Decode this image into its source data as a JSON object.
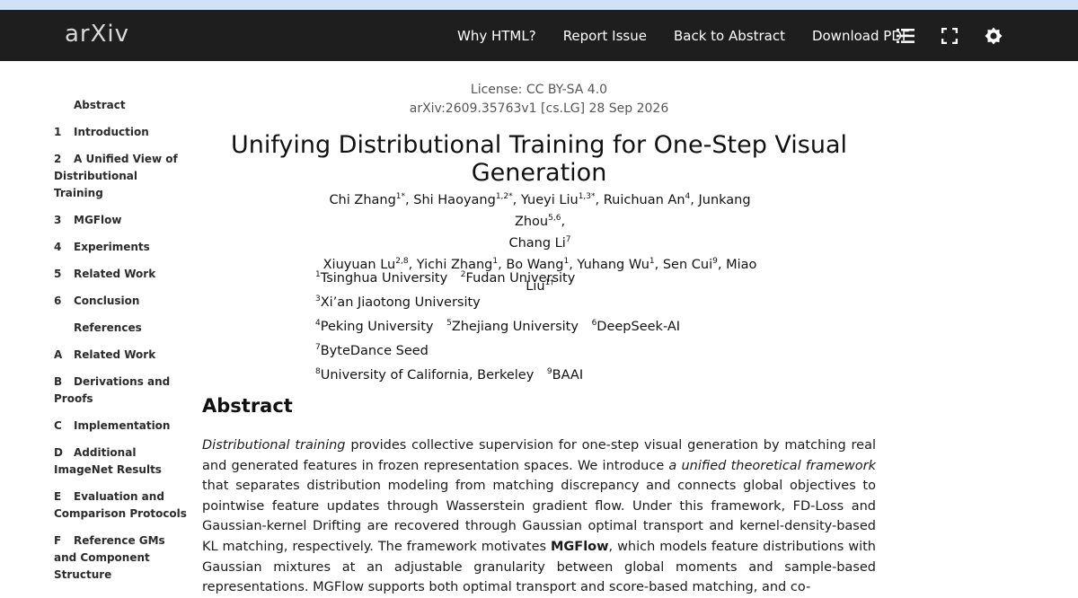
{
  "header": {
    "logo": "arXiv",
    "nav": [
      "Why HTML?",
      "Report Issue",
      "Back to Abstract",
      "Download PDF"
    ]
  },
  "toc": [
    {
      "num": "",
      "label": "Abstract"
    },
    {
      "num": "1",
      "label": "Introduction"
    },
    {
      "num": "2",
      "label": "A Unified View of Distributional Training"
    },
    {
      "num": "3",
      "label": "MGFlow"
    },
    {
      "num": "4",
      "label": "Experiments"
    },
    {
      "num": "5",
      "label": "Related Work"
    },
    {
      "num": "6",
      "label": "Conclusion"
    },
    {
      "num": "",
      "label": "References"
    },
    {
      "num": "A",
      "label": "Related Work"
    },
    {
      "num": "B",
      "label": "Derivations and Proofs"
    },
    {
      "num": "C",
      "label": "Implementation"
    },
    {
      "num": "D",
      "label": "Additional ImageNet Results"
    },
    {
      "num": "E",
      "label": "Evaluation and Comparison Protocols"
    },
    {
      "num": "F",
      "label": "Reference GMs and Component Structure"
    }
  ],
  "paper": {
    "license": "License: CC BY-SA 4.0",
    "arxiv_id": "arXiv:2609.35763v1 [cs.LG] 28 Sep 2026",
    "title": "Unifying Distributional Training for One-Step Visual Generation",
    "authors_line1": [
      {
        "name": "Chi Zhang",
        "sup": "1*"
      },
      {
        "name": "Shi Haoyang",
        "sup": "1,2*"
      },
      {
        "name": "Yueyi Liu",
        "sup": "1,3*"
      },
      {
        "name": "Ruichuan An",
        "sup": "4"
      },
      {
        "name": "Junkang Zhou",
        "sup": "5,6"
      }
    ],
    "authors_line2": [
      {
        "name": "Chang Li",
        "sup": "7"
      }
    ],
    "authors_line3": [
      {
        "name": "Xiuyuan Lu",
        "sup": "2,8"
      },
      {
        "name": "Yichi Zhang",
        "sup": "1"
      },
      {
        "name": "Bo Wang",
        "sup": "1"
      },
      {
        "name": "Yuhang Wu",
        "sup": "1"
      },
      {
        "name": "Sen Cui",
        "sup": "9"
      },
      {
        "name": "Miao Liu",
        "sup": "1†"
      }
    ],
    "affiliations": [
      {
        "sup": "1",
        "name": "Tsinghua University"
      },
      {
        "sup": "2",
        "name": "Fudan University"
      },
      {
        "sup": "3",
        "name": "Xi’an Jiaotong University"
      },
      {
        "sup": "4",
        "name": "Peking University"
      },
      {
        "sup": "5",
        "name": "Zhejiang University"
      },
      {
        "sup": "6",
        "name": "DeepSeek-AI"
      },
      {
        "sup": "7",
        "name": "ByteDance Seed"
      },
      {
        "sup": "8",
        "name": "University of California, Berkeley"
      },
      {
        "sup": "9",
        "name": "BAAI"
      }
    ],
    "abstract_heading": "Abstract",
    "abstract": {
      "p1_italic": "Distributional training",
      "p2": " provides collective supervision for one-step visual generation by matching real and generated features in frozen representation spaces. We introduce ",
      "p3_italic": "a unified theoretical framework",
      "p4": " that separates distribution modeling from matching discrepancy and connects global objectives to pointwise feature updates through Wasserstein gradient flow. Under this framework, FD-Loss and Gaussian-kernel Drifting are recovered through Gaussian optimal transport and kernel-density-based KL matching, respectively. The framework motivates ",
      "p5_bold": "MGFlow",
      "p6": ", which models feature distributions with Gaussian mixtures at an adjustable granularity between global moments and sample-based representations. MGFlow supports both optimal transport and score-based matching, and co-"
    }
  }
}
